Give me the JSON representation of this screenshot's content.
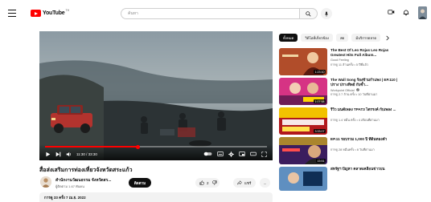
{
  "header": {
    "logo_text": "YouTube",
    "logo_region": "TH",
    "search_placeholder": "ค้นหา"
  },
  "player": {
    "time": "11:30 / 33:30",
    "progress": 0.42
  },
  "video": {
    "title": "สื่อส่งเสริมการท่องเที่ยวจังหวัดสระแก้ว",
    "channel": "สำนักงานวัฒนธรรม จังหวัดสร...",
    "subscribers": "ผู้ติดตาม 1.67 พันคน",
    "subscribe_label": "ติดตาม",
    "likes": "2",
    "share_label": "แชร์",
    "more_label": "...",
    "description_meta": "การดู 33 ครั้ง  7 เม.ย. 2022"
  },
  "chips": [
    {
      "label": "ทั้งหมด",
      "active": true
    },
    {
      "label": "วิดีโอที่เกี่ยวข้อง",
      "active": false
    },
    {
      "label": "สด",
      "active": false
    },
    {
      "label": "มีบริการตลาด",
      "active": false
    }
  ],
  "related": [
    {
      "title": "The Best Of Leo Rojas Leo Rojas Greatest Hits Full Album...",
      "channel": "Good Feeling",
      "stats": "การดู 11 ล้านครั้ง • 5 ปีที่แล้ว",
      "duration": "1:23:10"
    },
    {
      "title": "The Wall Song ร้องข้ามกำแพง | EP.110 | ปราง ปรางทิพย์ กับซ้ำ...",
      "channel": "Workpoint Official",
      "stats": "การดู 2.7 ล้าน ครั้ง • 10 วันที่ผ่านมา",
      "duration": "1:07:58"
    },
    {
      "title": "รีวิว มนต์เพลง TPAT3 ไตรรงค์ กับเพลง ...",
      "channel": "",
      "stats": "การดู 1.4 หมื่น ครั้ง • 4 เดือนที่ผ่านมา",
      "duration": "3:33:07"
    },
    {
      "title": "EP.11 รอบรวม 1,000 ปี ที่ดินทองคำ",
      "channel": "",
      "stats": "การดู 28 หมื่นครั้ง • 8 วันที่ผ่านมา",
      "duration": "15:51"
    },
    {
      "title": "สหรัฐฯ ปัญหา คลาดเคลื่อนข่าวบน",
      "channel": "",
      "stats": "",
      "duration": ""
    }
  ],
  "colors": {
    "brand_red": "#ff0000",
    "text": "#0f0f0f",
    "muted": "#606060"
  }
}
